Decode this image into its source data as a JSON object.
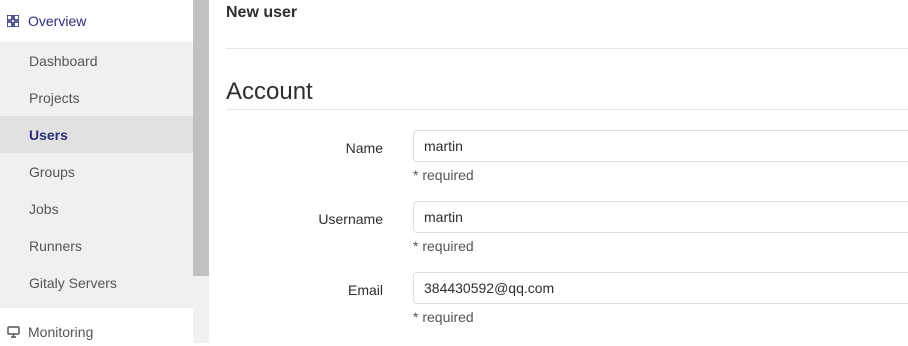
{
  "sidebar": {
    "overview_label": "Overview",
    "overview_icon": "grid-icon",
    "items": [
      {
        "label": "Dashboard"
      },
      {
        "label": "Projects"
      },
      {
        "label": "Users",
        "active": true
      },
      {
        "label": "Groups"
      },
      {
        "label": "Jobs"
      },
      {
        "label": "Runners"
      },
      {
        "label": "Gitaly Servers"
      }
    ],
    "monitoring_label": "Monitoring",
    "monitoring_icon": "monitor-icon",
    "accent_color": "#2d2d7a"
  },
  "page": {
    "title": "New user",
    "section_title": "Account"
  },
  "form": {
    "name": {
      "label": "Name",
      "value": "martin",
      "help": "* required"
    },
    "username": {
      "label": "Username",
      "value": "martin",
      "help": "* required"
    },
    "email": {
      "label": "Email",
      "value": "384430592@qq.com",
      "help": "* required"
    }
  }
}
